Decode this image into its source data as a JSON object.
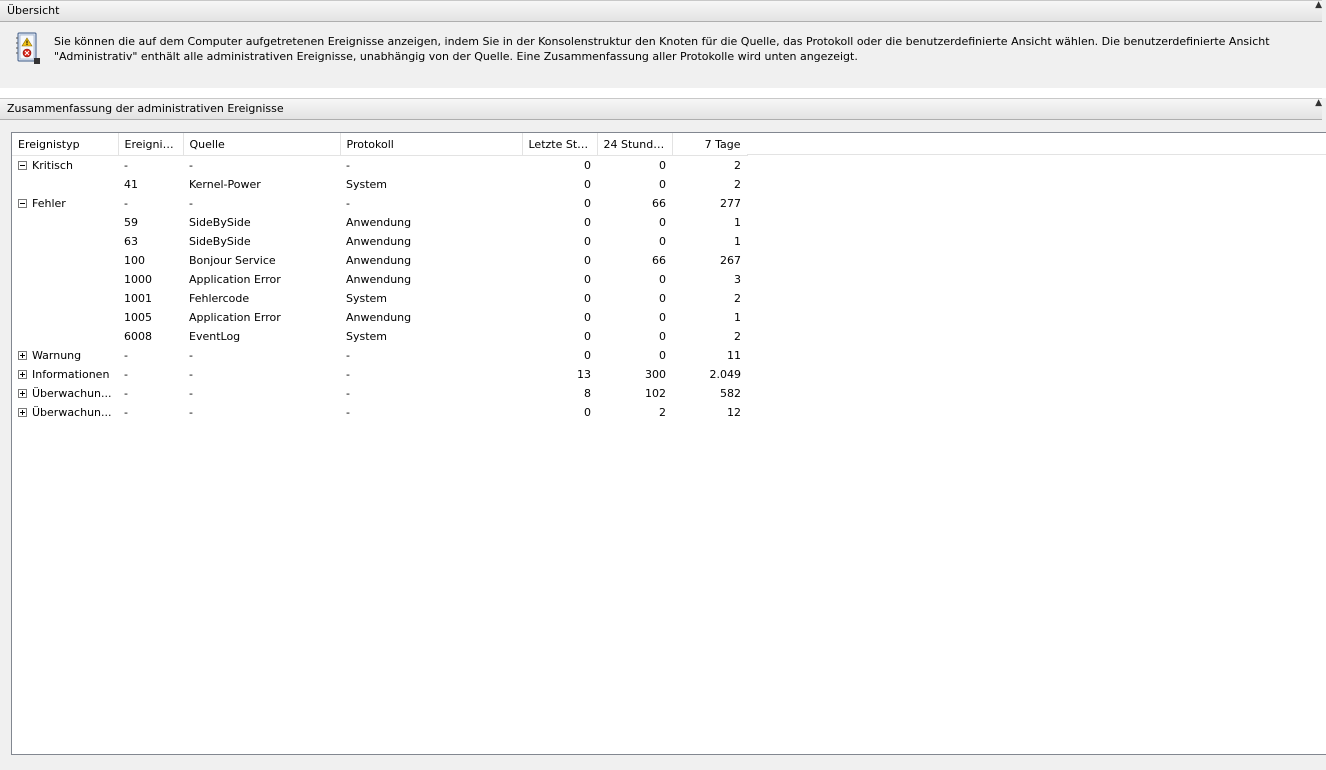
{
  "overview": {
    "header": "Übersicht",
    "icon": "event-log-icon",
    "description": "Sie können die auf dem Computer aufgetretenen Ereignisse anzeigen, indem Sie in der Konsolenstruktur den Knoten für die Quelle, das Protokoll oder die benutzerdefinierte Ansicht wählen. Die benutzerdefinierte Ansicht \"Administrativ\" enthält alle administrativen Ereignisse, unabhängig von der Quelle. Eine Zusammenfassung aller Protokolle wird unten angezeigt."
  },
  "summary": {
    "header": "Zusammenfassung der administrativen Ereignisse",
    "columns": [
      "Ereignistyp",
      "Ereignis...",
      "Quelle",
      "Protokoll",
      "Letzte Stu...",
      "24 Stunden",
      "7 Tage"
    ],
    "rows": [
      {
        "type": "Kritisch",
        "toggle": "minus",
        "id": "-",
        "source": "-",
        "log": "-",
        "hour": "0",
        "day": "0",
        "week": "2"
      },
      {
        "type": "",
        "toggle": "",
        "id": "41",
        "source": "Kernel-Power",
        "log": "System",
        "hour": "0",
        "day": "0",
        "week": "2"
      },
      {
        "type": "Fehler",
        "toggle": "minus",
        "id": "-",
        "source": "-",
        "log": "-",
        "hour": "0",
        "day": "66",
        "week": "277"
      },
      {
        "type": "",
        "toggle": "",
        "id": "59",
        "source": "SideBySide",
        "log": "Anwendung",
        "hour": "0",
        "day": "0",
        "week": "1"
      },
      {
        "type": "",
        "toggle": "",
        "id": "63",
        "source": "SideBySide",
        "log": "Anwendung",
        "hour": "0",
        "day": "0",
        "week": "1"
      },
      {
        "type": "",
        "toggle": "",
        "id": "100",
        "source": "Bonjour Service",
        "log": "Anwendung",
        "hour": "0",
        "day": "66",
        "week": "267"
      },
      {
        "type": "",
        "toggle": "",
        "id": "1000",
        "source": "Application Error",
        "log": "Anwendung",
        "hour": "0",
        "day": "0",
        "week": "3"
      },
      {
        "type": "",
        "toggle": "",
        "id": "1001",
        "source": "Fehlercode",
        "log": "System",
        "hour": "0",
        "day": "0",
        "week": "2"
      },
      {
        "type": "",
        "toggle": "",
        "id": "1005",
        "source": "Application Error",
        "log": "Anwendung",
        "hour": "0",
        "day": "0",
        "week": "1"
      },
      {
        "type": "",
        "toggle": "",
        "id": "6008",
        "source": "EventLog",
        "log": "System",
        "hour": "0",
        "day": "0",
        "week": "2"
      },
      {
        "type": "Warnung",
        "toggle": "plus",
        "id": "-",
        "source": "-",
        "log": "-",
        "hour": "0",
        "day": "0",
        "week": "11"
      },
      {
        "type": "Informationen",
        "toggle": "plus",
        "id": "-",
        "source": "-",
        "log": "-",
        "hour": "13",
        "day": "300",
        "week": "2.049"
      },
      {
        "type": "Überwachun...",
        "toggle": "plus",
        "id": "-",
        "source": "-",
        "log": "-",
        "hour": "8",
        "day": "102",
        "week": "582"
      },
      {
        "type": "Überwachun...",
        "toggle": "plus",
        "id": "-",
        "source": "-",
        "log": "-",
        "hour": "0",
        "day": "2",
        "week": "12"
      }
    ]
  }
}
